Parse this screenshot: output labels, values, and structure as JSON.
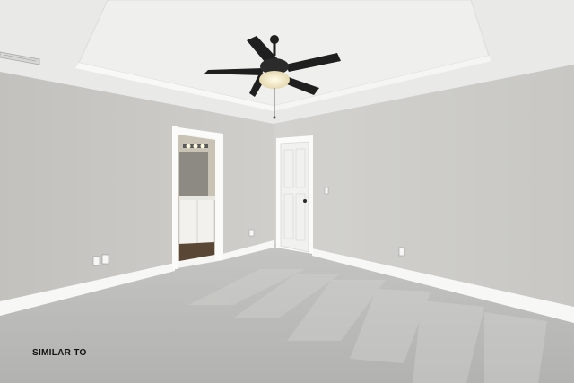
{
  "photo": {
    "caption": "SIMILAR TO",
    "colors": {
      "ceiling": "#ebebea",
      "wall_left": "#c9c8c4",
      "wall_right": "#cfceca",
      "trim": "#f6f6f4",
      "carpet": "#b8b8b6",
      "door": "#f4f4f2",
      "fan_blade": "#1f1f1f",
      "bathroom_floor": "#5a4634"
    }
  }
}
